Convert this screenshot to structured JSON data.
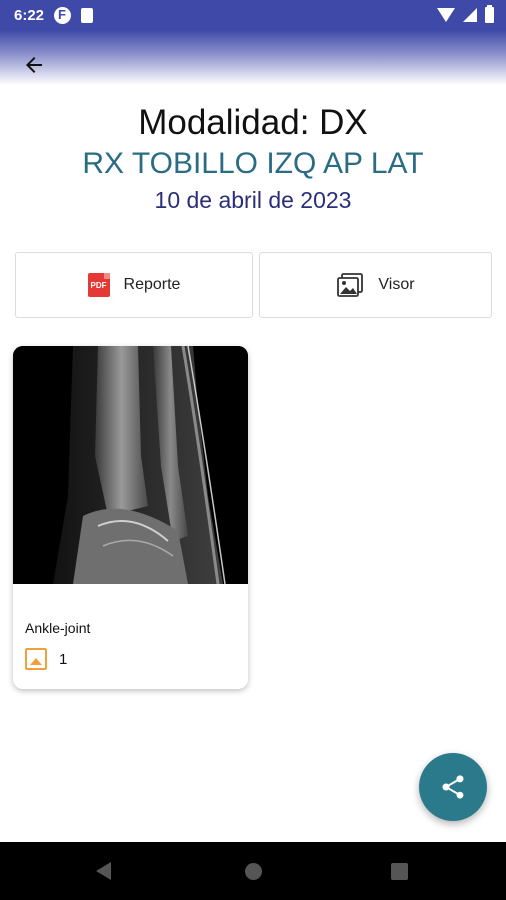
{
  "status_bar": {
    "time": "6:22",
    "icons": [
      "app-f-icon",
      "sd-card-icon",
      "wifi-icon",
      "signal-icon",
      "battery-icon"
    ]
  },
  "app_bar": {
    "back_icon": "arrow-back-icon"
  },
  "study": {
    "modality": "Modalidad: DX",
    "title": "RX TOBILLO IZQ AP LAT",
    "date": "10 de abril de 2023"
  },
  "actions": {
    "report_label": "Reporte",
    "report_icon_text": "PDF",
    "viewer_label": "Visor"
  },
  "series": [
    {
      "label": "Ankle-joint",
      "count": "1",
      "icon": "image-icon"
    }
  ],
  "fab": {
    "icon": "share-icon"
  },
  "colors": {
    "status_bar": "#3f4aa8",
    "title_teal": "#2b6c85",
    "date_navy": "#2b2f7a",
    "fab": "#2b7a8c",
    "pdf_red": "#e53935",
    "image_icon_orange": "#f0a03a"
  }
}
